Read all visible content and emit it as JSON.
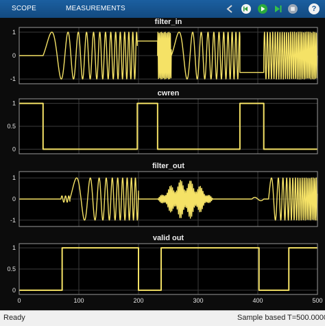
{
  "toolbar": {
    "tabs": [
      {
        "label": "SCOPE",
        "icon": "none"
      },
      {
        "label": "MEASUREMENTS",
        "icon": "none"
      }
    ],
    "buttons": [
      {
        "name": "back",
        "icon": "back-icon"
      },
      {
        "name": "step-back",
        "icon": "step-back-icon"
      },
      {
        "name": "run",
        "icon": "run-icon"
      },
      {
        "name": "step-forward",
        "icon": "step-forward-icon"
      },
      {
        "name": "stop",
        "icon": "stop-icon"
      }
    ],
    "help_label": "?"
  },
  "status": {
    "left": "Ready",
    "mode": "Sample based",
    "time": "T=500.0000"
  },
  "colors": {
    "trace": "#f5e266",
    "plot_bg": "#000000",
    "figure_bg": "#0c0c0c",
    "grid": "#3c3c3c",
    "toolbar": "#1a5a97",
    "statusbar": "#f0f0f0"
  },
  "chart_data": [
    {
      "type": "line",
      "title": "filter_in",
      "xlim": [
        0,
        500
      ],
      "ylim": [
        -1.2,
        1.2
      ],
      "yticks": [
        -1,
        0,
        1
      ],
      "grid": true,
      "segments": [
        {
          "kind": "flat",
          "x0": 0,
          "x1": 40,
          "y": 0
        },
        {
          "kind": "chirp",
          "x0": 40,
          "x1": 198,
          "amp": 1,
          "f0": 0.01,
          "f1": 0.16,
          "phase": 0
        },
        {
          "kind": "flat",
          "x0": 198,
          "x1": 232,
          "y": 0.62
        },
        {
          "kind": "chirp",
          "x0": 232,
          "x1": 255,
          "amp": 1,
          "f0": 0.48,
          "f1": 0.48,
          "phase": 0
        },
        {
          "kind": "chirp",
          "x0": 255,
          "x1": 370,
          "amp": 1,
          "f0": 0.01,
          "f1": 0.17,
          "phase": 0
        },
        {
          "kind": "flat",
          "x0": 370,
          "x1": 410,
          "y": -0.72
        },
        {
          "kind": "chirp",
          "x0": 410,
          "x1": 500,
          "amp": 1,
          "f0": 0.2,
          "f1": 0.4,
          "phase": 0
        }
      ]
    },
    {
      "type": "line",
      "title": "cwren",
      "xlim": [
        0,
        500
      ],
      "ylim": [
        -0.1,
        1.1
      ],
      "yticks": [
        0,
        0.5,
        1
      ],
      "grid": true,
      "steps": [
        [
          0,
          1
        ],
        [
          40,
          0
        ],
        [
          198,
          1
        ],
        [
          232,
          0
        ],
        [
          370,
          1
        ],
        [
          410,
          0
        ],
        [
          500,
          0
        ]
      ]
    },
    {
      "type": "line",
      "title": "filter_out",
      "xlim": [
        0,
        500
      ],
      "ylim": [
        -1.3,
        1.3
      ],
      "yticks": [
        -1,
        0,
        1
      ],
      "grid": true,
      "segments": [
        {
          "kind": "flat",
          "x0": 0,
          "x1": 70,
          "y": 0
        },
        {
          "kind": "chirp",
          "x0": 70,
          "x1": 85,
          "amp": 0.15,
          "f0": 0.15,
          "f1": 0.2,
          "phase": 0
        },
        {
          "kind": "chirp",
          "x0": 85,
          "x1": 200,
          "amp": 1,
          "f0": 0.015,
          "f1": 0.16,
          "phase": 0
        },
        {
          "kind": "flat",
          "x0": 200,
          "x1": 232,
          "y": 0
        },
        {
          "kind": "burst",
          "x0": 232,
          "x1": 325,
          "amp": 0.95,
          "freq": 0.45
        },
        {
          "kind": "flat",
          "x0": 325,
          "x1": 390,
          "y": 0
        },
        {
          "kind": "chirp",
          "x0": 390,
          "x1": 410,
          "amp": 0.08,
          "f0": 0.05,
          "f1": 0.05,
          "phase": 0
        },
        {
          "kind": "flat",
          "x0": 410,
          "x1": 418,
          "y": 0
        },
        {
          "kind": "chirp",
          "x0": 418,
          "x1": 500,
          "amp": 1,
          "f0": 0.04,
          "f1": 0.4,
          "phase": 0
        }
      ]
    },
    {
      "type": "line",
      "title": "valid out",
      "xlim": [
        0,
        500
      ],
      "ylim": [
        -0.1,
        1.1
      ],
      "yticks": [
        0,
        0.5,
        1
      ],
      "xticks": [
        0,
        100,
        200,
        300,
        400,
        500
      ],
      "grid": true,
      "steps": [
        [
          0,
          0
        ],
        [
          72,
          1
        ],
        [
          200,
          0
        ],
        [
          238,
          1
        ],
        [
          402,
          0
        ],
        [
          452,
          1
        ],
        [
          500,
          1
        ]
      ]
    }
  ]
}
